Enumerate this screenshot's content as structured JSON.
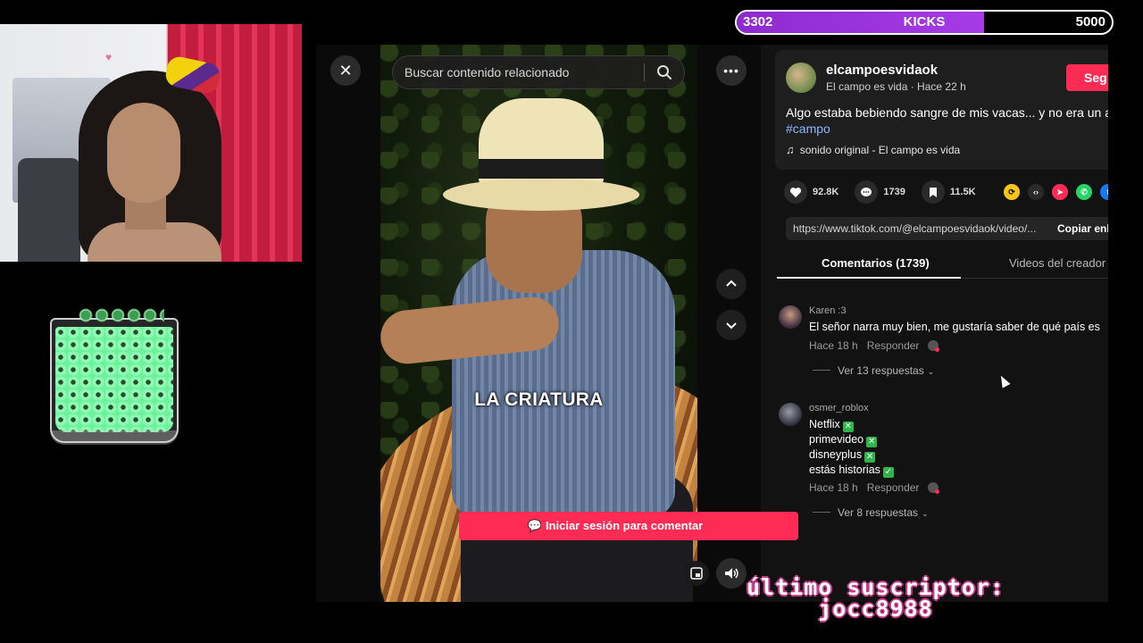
{
  "kicks": {
    "current": "3302",
    "label": "KICKS",
    "goal": "5000",
    "progress": 0.66
  },
  "viewer": {
    "search": {
      "placeholder": "Buscar contenido relacionado"
    },
    "video_caption": "LA CRIATURA"
  },
  "post": {
    "author": "elcampoesvidaok",
    "subline": "El campo es vida · Hace 22 h",
    "follow_label": "Seg",
    "description": "Algo estaba bebiendo sangre de mis vacas... y no era un an",
    "hashtag": "#campo",
    "sound": "sonido original - El campo es vida",
    "likes": "92.8K",
    "comments": "1739",
    "saves": "11.5K",
    "link": "https://www.tiktok.com/@elcampoesvidaok/video/...",
    "copy_label": "Copiar enl"
  },
  "tabs": {
    "comments": "Comentarios (1739)",
    "creator_videos": "Videos del creador"
  },
  "comments": [
    {
      "user": "Karen :3",
      "text_lines": [
        "El señor narra muy bien, me gustaría saber de qué país es"
      ],
      "time": "Hace 18 h",
      "reply_label": "Responder",
      "more": "Ver 13 respuestas"
    },
    {
      "user": "osmer_roblox",
      "text_lines": [
        "Netflix",
        "primevideo",
        "disneyplus",
        "estás historias"
      ],
      "time": "Hace 18 h",
      "reply_label": "Responder",
      "more": "Ver 8 respuestas"
    }
  ],
  "login_label": "Iniciar sesión para comentar",
  "overlay": {
    "line1": "último suscriptor:",
    "line2": "jocc8988"
  }
}
